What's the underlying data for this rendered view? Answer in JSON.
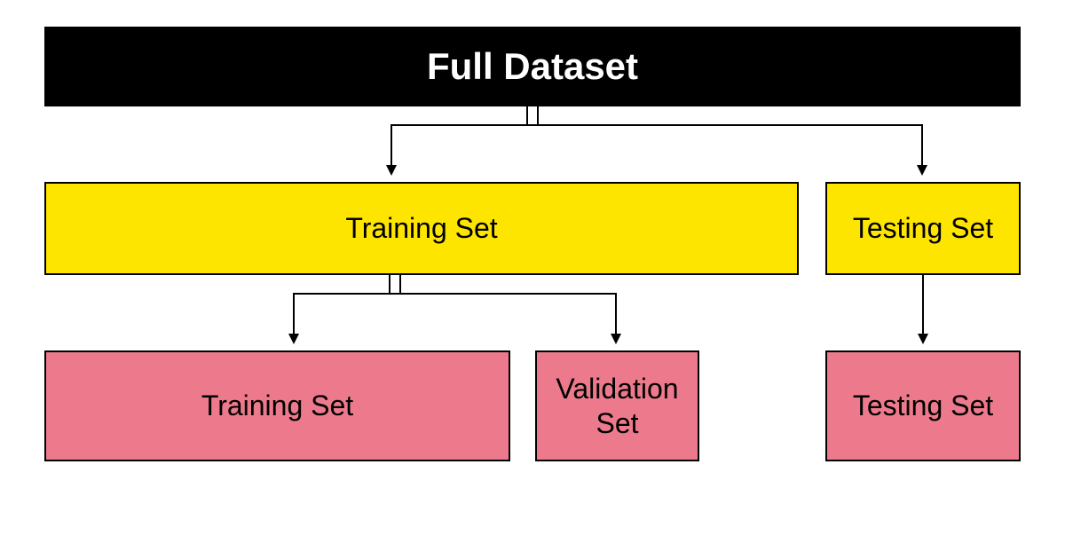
{
  "boxes": {
    "full_dataset": "Full Dataset",
    "training_set_l2": "Training Set",
    "testing_set_l2": "Testing Set",
    "training_set_l3": "Training Set",
    "validation_set_l3": "Validation Set",
    "testing_set_l3": "Testing Set"
  },
  "colors": {
    "black": "#000000",
    "yellow": "#fee500",
    "pink": "#ed7a8c",
    "white": "#ffffff"
  }
}
